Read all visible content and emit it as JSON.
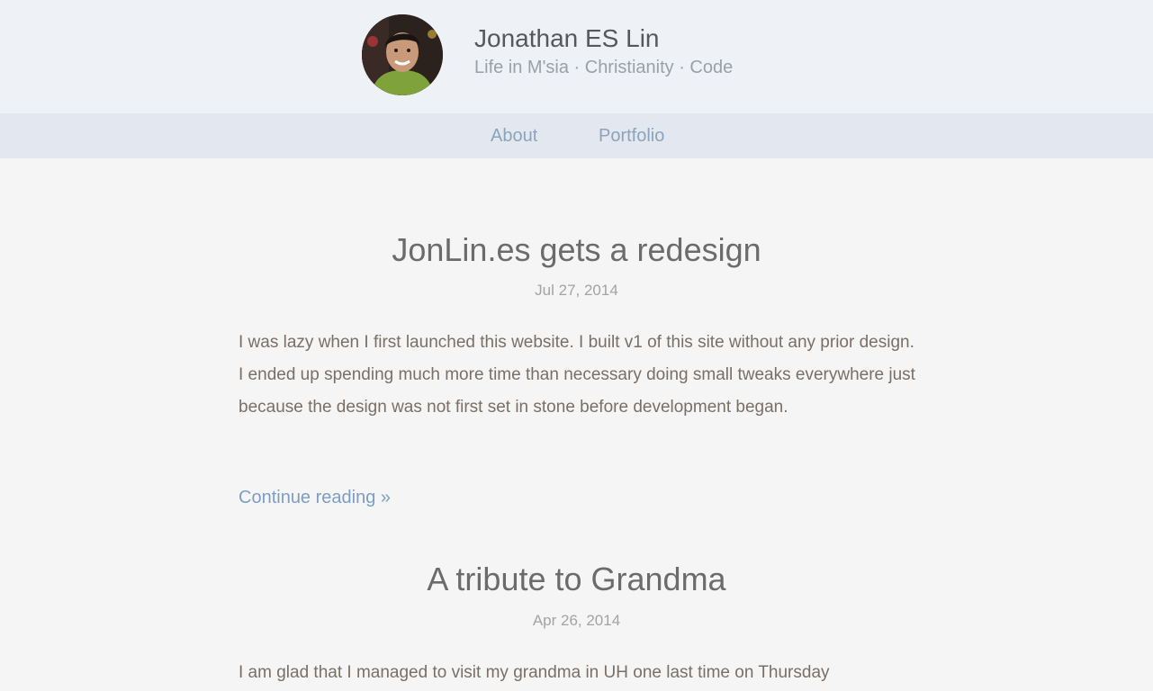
{
  "header": {
    "title": "Jonathan ES Lin",
    "tagline": "Life in M'sia · Christianity · Code"
  },
  "nav": {
    "items": [
      {
        "label": "About"
      },
      {
        "label": "Portfolio"
      }
    ]
  },
  "posts": [
    {
      "title": "JonLin.es gets a redesign",
      "date": "Jul 27, 2014",
      "excerpt": "I was lazy when I first launched this website. I built v1 of this site without any prior design. I ended up spending much more time than necessary doing small tweaks everywhere just because the design was not first set in stone before development began.",
      "continue_label": "Continue reading »"
    },
    {
      "title": "A tribute to Grandma",
      "date": "Apr 26, 2014",
      "excerpt": "I am glad that I managed to visit my grandma in UH one last time on Thursday"
    }
  ],
  "colors": {
    "header_bg": "#eef1f6",
    "nav_bg": "#e3e8f0",
    "page_bg": "#f5f5f5",
    "link": "#7c9dc9",
    "nav_link": "#8ca3bd"
  }
}
